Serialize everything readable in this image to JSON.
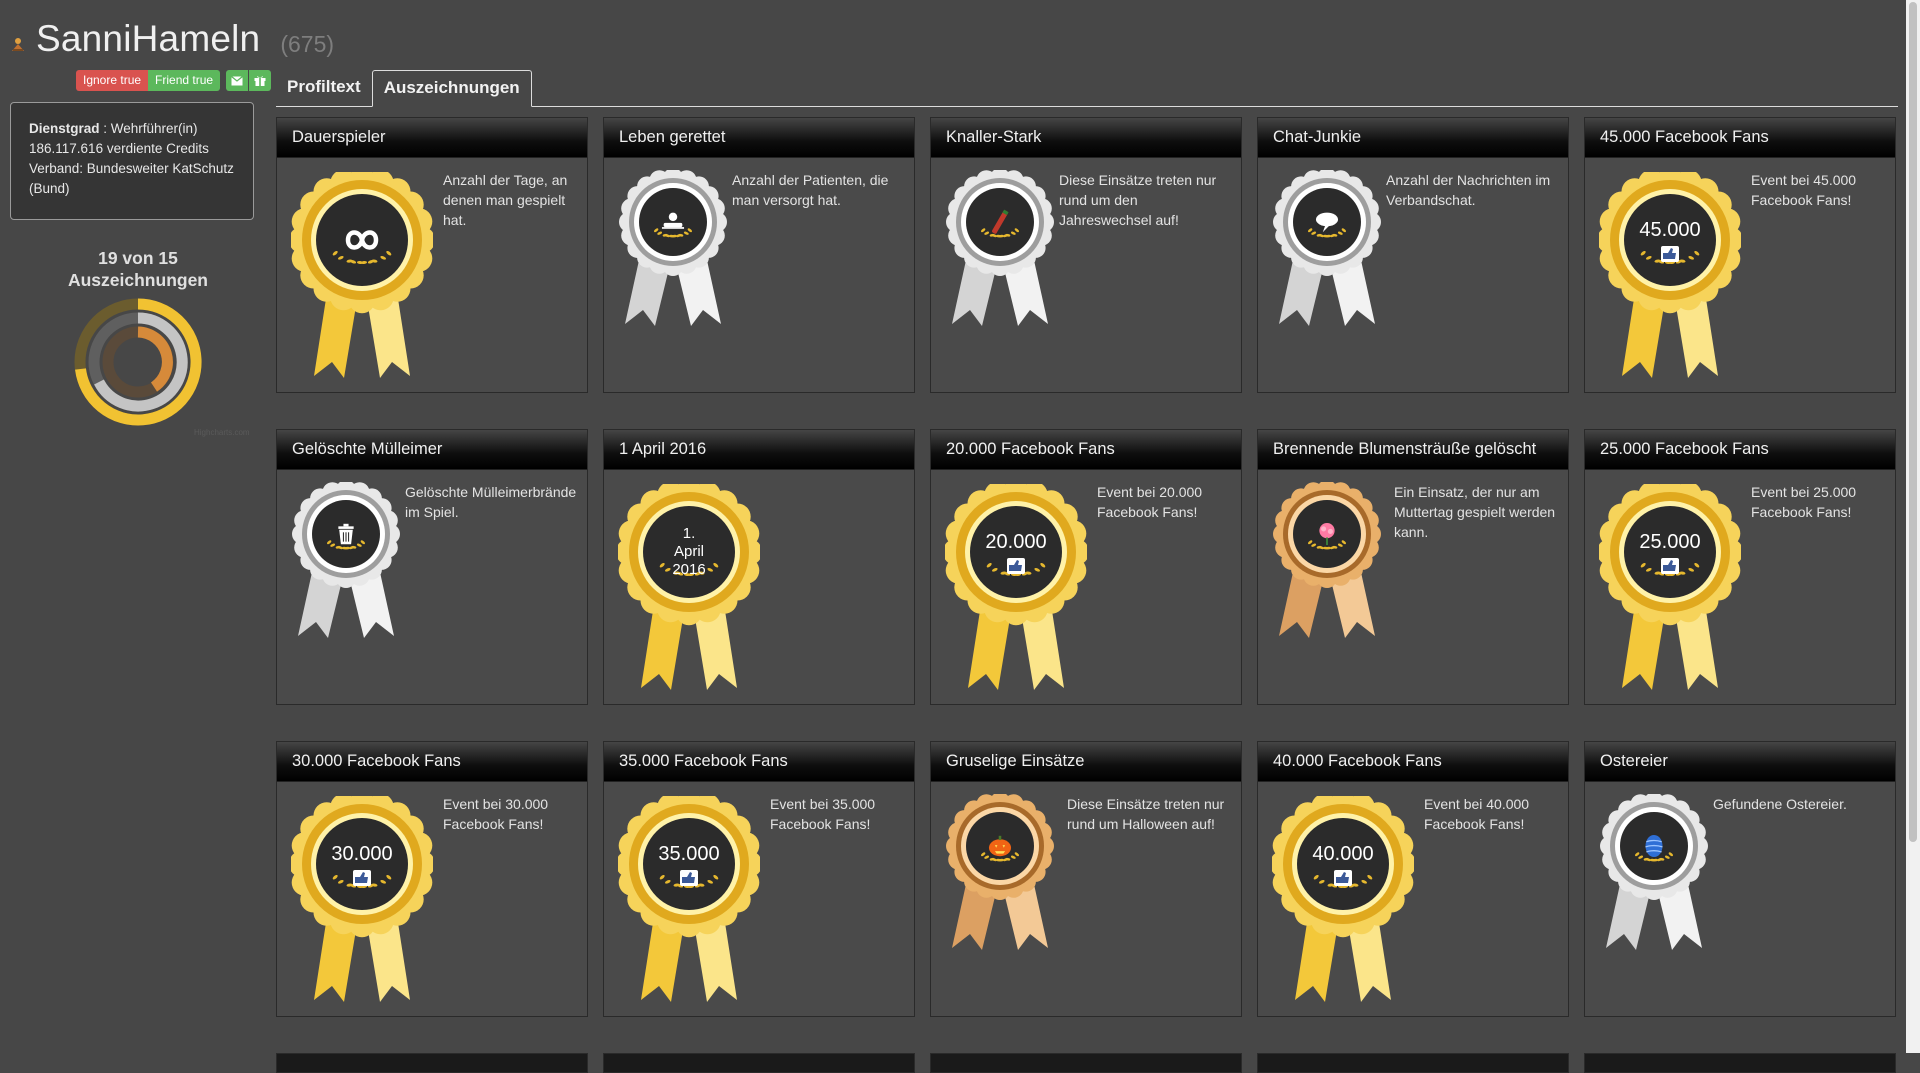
{
  "profile": {
    "name": "SanniHameln",
    "count": "(675)",
    "ignore_label": "Ignore true",
    "friend_label": "Friend true",
    "rank_label": "Dienstgrad",
    "rank_value": " : Wehrführer(in)",
    "credits": "186.117.616 verdiente Credits",
    "alliance_label": "Verband: ",
    "alliance_value": "Bundesweiter KatSchutz (Bund)"
  },
  "summary": {
    "line1": "19 von 15",
    "line2": "Auszeichnungen",
    "credit": "Highcharts.com"
  },
  "tabs": [
    {
      "label": "Profiltext"
    },
    {
      "label": "Auszeichnungen"
    }
  ],
  "awards": [
    {
      "title": "Dauerspieler",
      "desc": "Anzahl der Tage, an denen man gespielt hat.",
      "tier": "gold",
      "icon": "infinity-icon"
    },
    {
      "title": "Leben gerettet",
      "desc": "Anzahl der Patienten, die man versorgt hat.",
      "tier": "silver",
      "icon": "patient-icon"
    },
    {
      "title": "Knaller-Stark",
      "desc": "Diese Einsätze treten nur rund um den Jahreswechsel auf!",
      "tier": "silver",
      "icon": "firecracker-icon"
    },
    {
      "title": "Chat-Junkie",
      "desc": "Anzahl der Nachrichten im Verbandschat.",
      "tier": "silver",
      "icon": "speech-bubble-icon"
    },
    {
      "title": "45.000 Facebook Fans",
      "desc": "Event bei 45.000 Facebook Fans!",
      "tier": "gold",
      "icon": "thumbs-up-icon",
      "badge": "45.000"
    },
    {
      "title": "Gelöschte Mülleimer",
      "desc": "Gelöschte Mülleimerbrände im Spiel.",
      "tier": "silver",
      "icon": "trash-icon"
    },
    {
      "title": "1 April 2016",
      "desc": "",
      "tier": "gold",
      "icon": "calendar-icon",
      "badge": "1. April 2016"
    },
    {
      "title": "20.000 Facebook Fans",
      "desc": "Event bei 20.000 Facebook Fans!",
      "tier": "gold",
      "icon": "thumbs-up-icon",
      "badge": "20.000"
    },
    {
      "title": "Brennende Blumensträuße gelöscht",
      "desc": "Ein Einsatz, der nur am Muttertag gespielt werden kann.",
      "tier": "bronze",
      "icon": "flower-icon"
    },
    {
      "title": "25.000 Facebook Fans",
      "desc": "Event bei 25.000 Facebook Fans!",
      "tier": "gold",
      "icon": "thumbs-up-icon",
      "badge": "25.000"
    },
    {
      "title": "30.000 Facebook Fans",
      "desc": "Event bei 30.000 Facebook Fans!",
      "tier": "gold",
      "icon": "thumbs-up-icon",
      "badge": "30.000"
    },
    {
      "title": "35.000 Facebook Fans",
      "desc": "Event bei 35.000 Facebook Fans!",
      "tier": "gold",
      "icon": "thumbs-up-icon",
      "badge": "35.000"
    },
    {
      "title": "Gruselige Einsätze",
      "desc": "Diese Einsätze treten nur rund um Halloween auf!",
      "tier": "bronze",
      "icon": "pumpkin-icon"
    },
    {
      "title": "40.000 Facebook Fans",
      "desc": "Event bei 40.000 Facebook Fans!",
      "tier": "gold",
      "icon": "thumbs-up-icon",
      "badge": "40.000"
    },
    {
      "title": "Ostereier",
      "desc": "Gefundene Ostereier.",
      "tier": "silver",
      "icon": "easter-egg-icon"
    }
  ],
  "colors": {
    "gold": "#f1c232",
    "silver": "#cfcfcf",
    "bronze": "#d59a4e",
    "ignore": "#d9534f",
    "friend": "#5cb85c"
  }
}
